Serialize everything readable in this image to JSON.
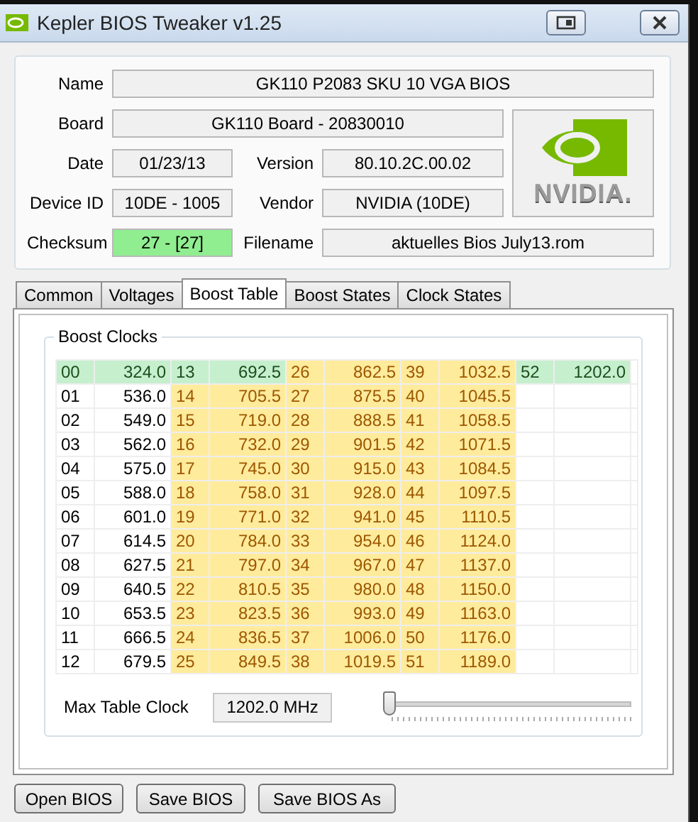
{
  "window": {
    "title": "Kepler BIOS Tweaker v1.25"
  },
  "info": {
    "name": {
      "label": "Name",
      "value": "GK110 P2083 SKU 10 VGA BIOS"
    },
    "board": {
      "label": "Board",
      "value": "GK110 Board - 20830010"
    },
    "date": {
      "label": "Date",
      "value": "01/23/13"
    },
    "version": {
      "label": "Version",
      "value": "80.10.2C.00.02"
    },
    "device_id": {
      "label": "Device ID",
      "value": "10DE - 1005"
    },
    "vendor": {
      "label": "Vendor",
      "value": "NVIDIA (10DE)"
    },
    "checksum": {
      "label": "Checksum",
      "value": "27 - [27]",
      "highlight": true
    },
    "filename": {
      "label": "Filename",
      "value": "aktuelles Bios July13.rom",
      "highlight": false
    },
    "logo_text": "NVIDIA."
  },
  "tabs": [
    {
      "label": "Common",
      "selected": false
    },
    {
      "label": "Voltages",
      "selected": false
    },
    {
      "label": "Boost Table",
      "selected": true
    },
    {
      "label": "Boost States",
      "selected": false
    },
    {
      "label": "Clock States",
      "selected": false
    }
  ],
  "boost_clocks": {
    "title": "Boost Clocks",
    "rows": [
      [
        {
          "index": "00",
          "clock": "324.0",
          "kind": "green"
        },
        {
          "index": "13",
          "clock": "692.5",
          "kind": "green"
        },
        {
          "index": "26",
          "clock": "862.5",
          "kind": "yellow"
        },
        {
          "index": "39",
          "clock": "1032.5",
          "kind": "yellow"
        },
        {
          "index": "52",
          "clock": "1202.0",
          "kind": "green"
        }
      ],
      [
        {
          "index": "01",
          "clock": "536.0",
          "kind": "plain"
        },
        {
          "index": "14",
          "clock": "705.5",
          "kind": "yellow"
        },
        {
          "index": "27",
          "clock": "875.5",
          "kind": "yellow"
        },
        {
          "index": "40",
          "clock": "1045.5",
          "kind": "yellow"
        }
      ],
      [
        {
          "index": "02",
          "clock": "549.0",
          "kind": "plain"
        },
        {
          "index": "15",
          "clock": "719.0",
          "kind": "yellow"
        },
        {
          "index": "28",
          "clock": "888.5",
          "kind": "yellow"
        },
        {
          "index": "41",
          "clock": "1058.5",
          "kind": "yellow"
        }
      ],
      [
        {
          "index": "03",
          "clock": "562.0",
          "kind": "plain"
        },
        {
          "index": "16",
          "clock": "732.0",
          "kind": "yellow"
        },
        {
          "index": "29",
          "clock": "901.5",
          "kind": "yellow"
        },
        {
          "index": "42",
          "clock": "1071.5",
          "kind": "yellow"
        }
      ],
      [
        {
          "index": "04",
          "clock": "575.0",
          "kind": "plain"
        },
        {
          "index": "17",
          "clock": "745.0",
          "kind": "yellow"
        },
        {
          "index": "30",
          "clock": "915.0",
          "kind": "yellow"
        },
        {
          "index": "43",
          "clock": "1084.5",
          "kind": "yellow"
        }
      ],
      [
        {
          "index": "05",
          "clock": "588.0",
          "kind": "plain"
        },
        {
          "index": "18",
          "clock": "758.0",
          "kind": "yellow"
        },
        {
          "index": "31",
          "clock": "928.0",
          "kind": "yellow"
        },
        {
          "index": "44",
          "clock": "1097.5",
          "kind": "yellow"
        }
      ],
      [
        {
          "index": "06",
          "clock": "601.0",
          "kind": "plain"
        },
        {
          "index": "19",
          "clock": "771.0",
          "kind": "yellow"
        },
        {
          "index": "32",
          "clock": "941.0",
          "kind": "yellow"
        },
        {
          "index": "45",
          "clock": "1110.5",
          "kind": "yellow"
        }
      ],
      [
        {
          "index": "07",
          "clock": "614.5",
          "kind": "plain"
        },
        {
          "index": "20",
          "clock": "784.0",
          "kind": "yellow"
        },
        {
          "index": "33",
          "clock": "954.0",
          "kind": "yellow"
        },
        {
          "index": "46",
          "clock": "1124.0",
          "kind": "yellow"
        }
      ],
      [
        {
          "index": "08",
          "clock": "627.5",
          "kind": "plain"
        },
        {
          "index": "21",
          "clock": "797.0",
          "kind": "yellow"
        },
        {
          "index": "34",
          "clock": "967.0",
          "kind": "yellow"
        },
        {
          "index": "47",
          "clock": "1137.0",
          "kind": "yellow"
        }
      ],
      [
        {
          "index": "09",
          "clock": "640.5",
          "kind": "plain"
        },
        {
          "index": "22",
          "clock": "810.5",
          "kind": "yellow"
        },
        {
          "index": "35",
          "clock": "980.0",
          "kind": "yellow"
        },
        {
          "index": "48",
          "clock": "1150.0",
          "kind": "yellow"
        }
      ],
      [
        {
          "index": "10",
          "clock": "653.5",
          "kind": "plain"
        },
        {
          "index": "23",
          "clock": "823.5",
          "kind": "yellow"
        },
        {
          "index": "36",
          "clock": "993.0",
          "kind": "yellow"
        },
        {
          "index": "49",
          "clock": "1163.0",
          "kind": "yellow"
        }
      ],
      [
        {
          "index": "11",
          "clock": "666.5",
          "kind": "plain"
        },
        {
          "index": "24",
          "clock": "836.5",
          "kind": "yellow"
        },
        {
          "index": "37",
          "clock": "1006.0",
          "kind": "yellow"
        },
        {
          "index": "50",
          "clock": "1176.0",
          "kind": "yellow"
        }
      ],
      [
        {
          "index": "12",
          "clock": "679.5",
          "kind": "plain"
        },
        {
          "index": "25",
          "clock": "849.5",
          "kind": "yellow"
        },
        {
          "index": "38",
          "clock": "1019.5",
          "kind": "yellow"
        },
        {
          "index": "51",
          "clock": "1189.0",
          "kind": "yellow"
        }
      ]
    ],
    "max_label": "Max Table Clock",
    "max_value": "1202.0 MHz",
    "slider": {
      "level": 0
    }
  },
  "buttons": [
    "Open BIOS",
    "Save BIOS",
    "Save BIOS As"
  ]
}
